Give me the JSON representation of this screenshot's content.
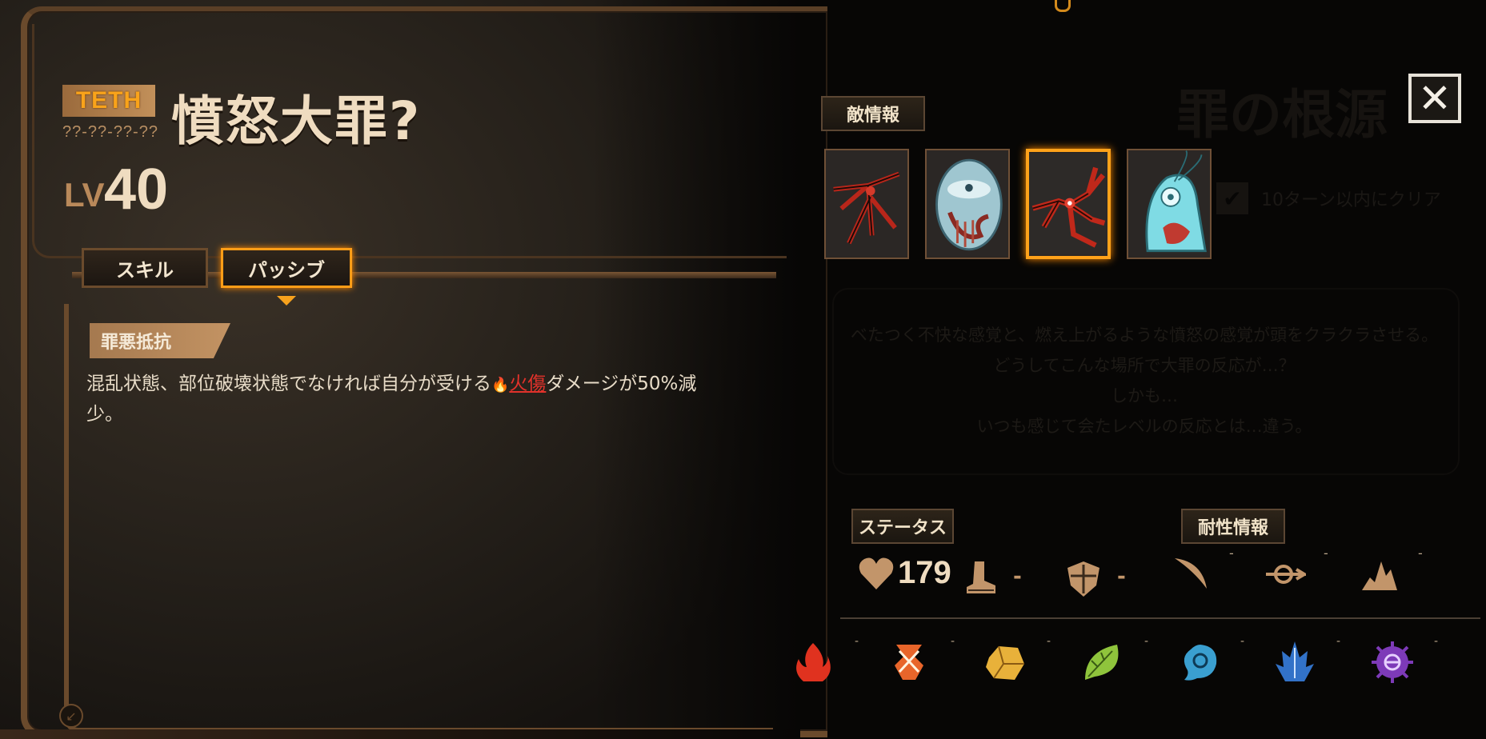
{
  "enemy": {
    "rank": "TETH",
    "code": "??-??-??-??",
    "name": "憤怒大罪?",
    "level_label": "LV",
    "level": "40"
  },
  "tabs": [
    {
      "label": "スキル",
      "selected": false
    },
    {
      "label": "パッシブ",
      "selected": true
    }
  ],
  "passive": {
    "title": "罪悪抵抗",
    "desc_before": "混乱状態、部位破壊状態でなければ自分が受ける",
    "burn_label": "火傷",
    "desc_after": "ダメージが50%減少。"
  },
  "right": {
    "bg_title": "罪の根源",
    "enemy_info_label": "敵情報",
    "clear_condition": "10ターン以内にクリア",
    "flavor_lines": [
      "ベたつく不快な感覚と、燃え上がるような憤怒の感覚が頭をクラクラさせる。",
      "どうしてこんな場所で大罪の反応が…？",
      "しかも…",
      "いつも感じて会たレベルの反応とは…違う。"
    ],
    "status_label": "ステータス",
    "resist_label": "耐性情報",
    "hp": "179",
    "speed_value": "-",
    "defense_value": "-",
    "close_icon": "close-icon"
  },
  "portraits": [
    {
      "name": "crimson-thorn-creature",
      "selected": false
    },
    {
      "name": "blue-egg-creature",
      "selected": false
    },
    {
      "name": "red-eye-branch-creature",
      "selected": true
    },
    {
      "name": "cyan-ghost-creature",
      "selected": false
    }
  ],
  "resist": {
    "attack_types": [
      {
        "icon": "slash-icon",
        "value": "-"
      },
      {
        "icon": "pierce-icon",
        "value": "-"
      },
      {
        "icon": "blunt-icon",
        "value": "-"
      }
    ],
    "sins": [
      {
        "icon": "wrath-icon",
        "color": "#e0321f",
        "value": "-"
      },
      {
        "icon": "lust-icon",
        "color": "#e8652a",
        "value": "-"
      },
      {
        "icon": "sloth-icon",
        "color": "#e8b13a",
        "value": "-"
      },
      {
        "icon": "gluttony-icon",
        "color": "#8fc43c",
        "value": "-"
      },
      {
        "icon": "gloom-icon",
        "color": "#3a9fd0",
        "value": "-"
      },
      {
        "icon": "pride-icon",
        "color": "#3272c8",
        "value": "-"
      },
      {
        "icon": "envy-icon",
        "color": "#7d3ab8",
        "value": "-"
      }
    ]
  }
}
